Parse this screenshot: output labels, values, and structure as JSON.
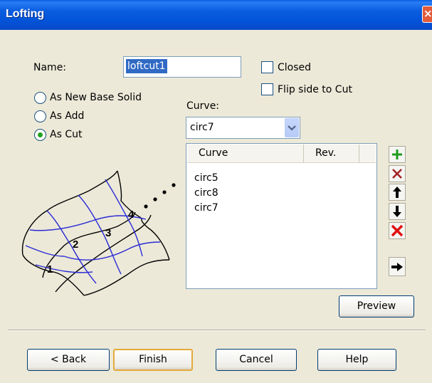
{
  "window": {
    "title": "Lofting",
    "close_glyph": "×"
  },
  "name_field": {
    "label": "Name:",
    "value": "loftcut1"
  },
  "options": {
    "closed_label": "Closed",
    "flip_label": "Flip side to Cut"
  },
  "radios": [
    {
      "label": "As New Base Solid",
      "checked": false
    },
    {
      "label": "As Add",
      "checked": false
    },
    {
      "label": "As Cut",
      "checked": true
    }
  ],
  "curve_select": {
    "label": "Curve:",
    "value": "circ7"
  },
  "curve_list": {
    "columns": [
      "Curve",
      "Rev."
    ],
    "rows": [
      {
        "curve": "circ5",
        "rev": ""
      },
      {
        "curve": "circ8",
        "rev": ""
      },
      {
        "curve": "circ7",
        "rev": ""
      }
    ]
  },
  "side_buttons": [
    {
      "icon": "plus-icon",
      "color": "#1e9a1e"
    },
    {
      "icon": "remove-x-icon",
      "color": "#a32020"
    },
    {
      "icon": "arrow-up-icon",
      "color": "#000000"
    },
    {
      "icon": "arrow-down-icon",
      "color": "#000000"
    },
    {
      "icon": "delete-all-x-icon",
      "color": "#e01010"
    },
    {
      "icon": "arrow-right-icon",
      "color": "#000000"
    }
  ],
  "illustration": {
    "section_numbers": [
      "1",
      "2",
      "3",
      "4"
    ]
  },
  "preview_button": "Preview",
  "footer": {
    "back": "< Back",
    "finish": "Finish",
    "cancel": "Cancel",
    "help": "Help"
  }
}
